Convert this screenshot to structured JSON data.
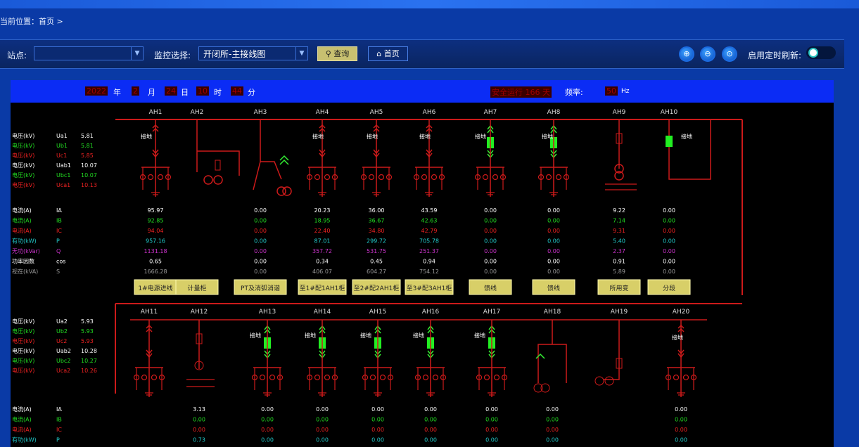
{
  "breadcrumb": {
    "text": "当前位置：首页 >"
  },
  "toolbar": {
    "station_label": "站点:",
    "station_value": "",
    "monitor_label": "监控选择:",
    "monitor_value": "开闭所-主接线图",
    "query_label": "查询",
    "home_label": "首页",
    "refresh_label": "启用定时刷新:",
    "refresh_on": true
  },
  "datebar": {
    "year": "2022",
    "year_unit": "年",
    "month": "2",
    "month_unit": "月",
    "day": "24",
    "day_unit": "日",
    "hour": "10",
    "hour_unit": "时",
    "minute": "44",
    "minute_unit": "分",
    "safe_run": "安全运行 166 天",
    "freq_label": "频率:",
    "freq_value": "50",
    "freq_unit": "Hz"
  },
  "top": {
    "cabinets": [
      "AH1",
      "AH2",
      "AH3",
      "AH4",
      "AH5",
      "AH6",
      "AH7",
      "AH8",
      "AH9",
      "AH10"
    ],
    "voltages": [
      {
        "label": "电压(kV)",
        "code": "Ua1",
        "value": "5.81",
        "color": "#ffffff"
      },
      {
        "label": "电压(kV)",
        "code": "Ub1",
        "value": "5.81",
        "color": "#22dd22"
      },
      {
        "label": "电压(kV)",
        "code": "Uc1",
        "value": "5.85",
        "color": "#ee2222"
      },
      {
        "label": "电压(kV)",
        "code": "Uab1",
        "value": "10.07",
        "color": "#ffffff"
      },
      {
        "label": "电压(kV)",
        "code": "Ubc1",
        "value": "10.07",
        "color": "#22dd22"
      },
      {
        "label": "电压(kV)",
        "code": "Uca1",
        "value": "10.13",
        "color": "#ee2222"
      }
    ],
    "measures": [
      {
        "label": "电流(A)",
        "code": "IA",
        "color": "#ffffff",
        "values": [
          "95.97",
          "",
          "0.00",
          "20.23",
          "36.00",
          "43.59",
          "0.00",
          "0.00",
          "9.22",
          "0.00"
        ]
      },
      {
        "label": "电流(A)",
        "code": "IB",
        "color": "#22dd22",
        "values": [
          "92.85",
          "",
          "0.00",
          "18.95",
          "36.67",
          "42.63",
          "0.00",
          "0.00",
          "7.14",
          "0.00"
        ]
      },
      {
        "label": "电流(A)",
        "code": "IC",
        "color": "#ee2222",
        "values": [
          "94.04",
          "",
          "0.00",
          "22.40",
          "34.80",
          "42.79",
          "0.00",
          "0.00",
          "9.31",
          "0.00"
        ]
      },
      {
        "label": "有功(kW)",
        "code": "P",
        "color": "#22cccc",
        "values": [
          "957.16",
          "",
          "0.00",
          "87.01",
          "299.72",
          "705.78",
          "0.00",
          "0.00",
          "5.40",
          "0.00"
        ]
      },
      {
        "label": "无功(kVar)",
        "code": "Q",
        "color": "#cc33cc",
        "values": [
          "1131.18",
          "",
          "0.00",
          "357.72",
          "531.75",
          "251.37",
          "0.00",
          "0.00",
          "2.37",
          "0.00"
        ]
      },
      {
        "label": "功率因数",
        "code": "cos",
        "color": "#ffffff",
        "values": [
          "0.65",
          "",
          "0.00",
          "0.34",
          "0.45",
          "0.94",
          "0.00",
          "0.00",
          "0.91",
          "0.00"
        ]
      },
      {
        "label": "视在(kVA)",
        "code": "S",
        "color": "#999999",
        "values": [
          "1666.28",
          "",
          "0.00",
          "406.07",
          "604.27",
          "754.12",
          "0.00",
          "0.00",
          "5.89",
          "0.00"
        ]
      }
    ],
    "names": [
      "1#电源进线",
      "计量柜",
      "PT及消弧消谐",
      "至1#配1AH1柜",
      "至2#配2AH1柜",
      "至3#配3AH1柜",
      "馈线",
      "馈线",
      "所用变",
      "分段"
    ],
    "ground_label": "接地"
  },
  "bottom": {
    "cabinets": [
      "AH11",
      "AH12",
      "AH13",
      "AH14",
      "AH15",
      "AH16",
      "AH17",
      "AH18",
      "AH19",
      "AH20"
    ],
    "voltages": [
      {
        "label": "电压(kV)",
        "code": "Ua2",
        "value": "5.93",
        "color": "#ffffff"
      },
      {
        "label": "电压(kV)",
        "code": "Ub2",
        "value": "5.93",
        "color": "#22dd22"
      },
      {
        "label": "电压(kV)",
        "code": "Uc2",
        "value": "5.93",
        "color": "#ee2222"
      },
      {
        "label": "电压(kV)",
        "code": "Uab2",
        "value": "10.28",
        "color": "#ffffff"
      },
      {
        "label": "电压(kV)",
        "code": "Ubc2",
        "value": "10.27",
        "color": "#22dd22"
      },
      {
        "label": "电压(kV)",
        "code": "Uca2",
        "value": "10.26",
        "color": "#ee2222"
      }
    ],
    "measures": [
      {
        "label": "电流(A)",
        "code": "IA",
        "color": "#ffffff",
        "values": [
          "",
          "3.13",
          "0.00",
          "0.00",
          "0.00",
          "0.00",
          "0.00",
          "0.00",
          "",
          "0.00"
        ]
      },
      {
        "label": "电流(A)",
        "code": "IB",
        "color": "#22dd22",
        "values": [
          "",
          "0.00",
          "0.00",
          "0.00",
          "0.00",
          "0.00",
          "0.00",
          "0.00",
          "",
          "0.00"
        ]
      },
      {
        "label": "电流(A)",
        "code": "IC",
        "color": "#ee2222",
        "values": [
          "",
          "0.00",
          "0.00",
          "0.00",
          "0.00",
          "0.00",
          "0.00",
          "0.00",
          "",
          "0.00"
        ]
      },
      {
        "label": "有功(kW)",
        "code": "P",
        "color": "#22cccc",
        "values": [
          "",
          "0.73",
          "0.00",
          "0.00",
          "0.00",
          "0.00",
          "0.00",
          "0.00",
          "",
          "0.00"
        ]
      }
    ],
    "ground_label": "接地"
  }
}
